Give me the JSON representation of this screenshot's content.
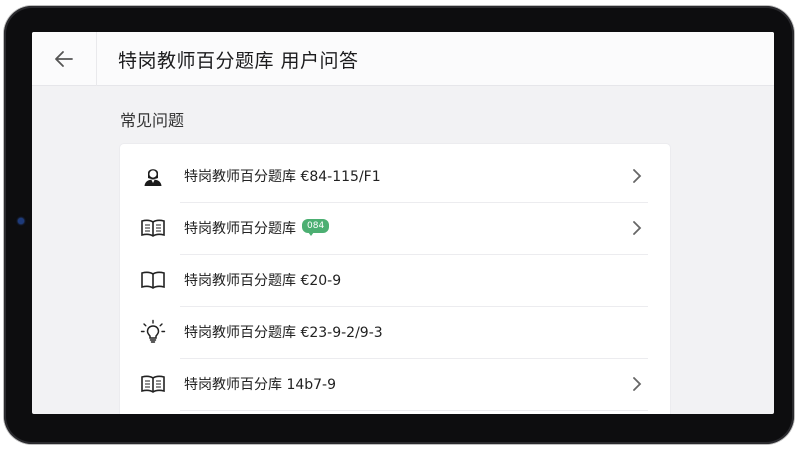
{
  "header": {
    "title": "特岗教师百分题库  用户问答",
    "back_icon": "arrow-left-icon"
  },
  "section": {
    "title": "常见问题"
  },
  "faq_items": [
    {
      "label": "特岗教师百分题库 €84-115/F1",
      "icon": "user-avatar-icon",
      "badge": "",
      "has_chevron": true
    },
    {
      "label": "特岗教师百分题库",
      "icon": "open-book-icon",
      "badge": "084",
      "has_chevron": true
    },
    {
      "label": "特岗教师百分题库 €20-9",
      "icon": "open-book-icon",
      "badge": "",
      "has_chevron": false
    },
    {
      "label": "特岗教师百分题库 €23-9-2/9-3",
      "icon": "lightbulb-icon",
      "badge": "",
      "has_chevron": false
    },
    {
      "label": "特岗教师百分库 14b7-9",
      "icon": "open-book-icon",
      "badge": "",
      "has_chevron": true
    }
  ],
  "colors": {
    "bezel": "#0d0d0f",
    "screen_bg": "#f2f2f4",
    "badge_green": "#4caf72"
  }
}
